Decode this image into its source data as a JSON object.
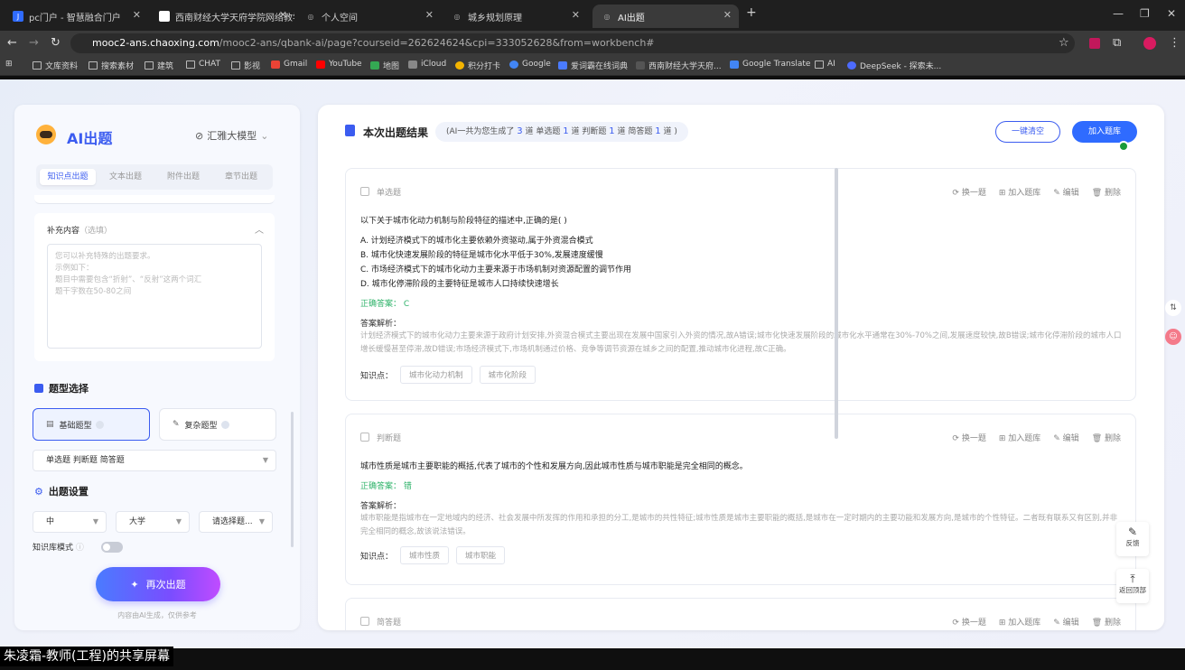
{
  "browser": {
    "tabs": [
      {
        "title": "pc门户 - 智慧融合门户",
        "favicon_color": "#2f6bff",
        "favicon_glyph": "J"
      },
      {
        "title": "西南财经大学天府学院网络教学",
        "favicon_color": "#ffffff",
        "favicon_glyph": ""
      },
      {
        "title": "个人空间",
        "favicon_color": "#666666",
        "favicon_glyph": "◎"
      },
      {
        "title": "城乡规划原理",
        "favicon_color": "#666666",
        "favicon_glyph": "◎"
      },
      {
        "title": "AI出题",
        "favicon_color": "#666666",
        "favicon_glyph": "◎"
      }
    ],
    "new_tab_icon": "plus-icon",
    "url_host": "mooc2-ans.chaoxing.com",
    "url_path": "/mooc2-ans/qbank-ai/page?courseid=262624624&cpi=333052628&from=workbench#",
    "bookmarks": [
      {
        "label": "文库资料",
        "color": ""
      },
      {
        "label": "搜索素材",
        "color": ""
      },
      {
        "label": "建筑",
        "color": ""
      },
      {
        "label": "CHAT",
        "color": ""
      },
      {
        "label": "影视",
        "color": ""
      },
      {
        "label": "Gmail",
        "color": "#ea4335"
      },
      {
        "label": "YouTube",
        "color": "#ff0000"
      },
      {
        "label": "地图",
        "color": "#34a853"
      },
      {
        "label": "iCloud",
        "color": "#888888"
      },
      {
        "label": "积分打卡",
        "color": "#f4b400"
      },
      {
        "label": "Google",
        "color": "#4285f4"
      },
      {
        "label": "爱词霸在线词典",
        "color": "#4a7bff"
      },
      {
        "label": "西南财经大学天府...",
        "color": "#3a3a3a"
      },
      {
        "label": "Google Translate",
        "color": "#4285f4"
      },
      {
        "label": "AI",
        "color": ""
      },
      {
        "label": "DeepSeek - 探索未...",
        "color": "#4d6bfe"
      }
    ]
  },
  "left_panel": {
    "title": "AI出题",
    "model_label": "汇雅大模型",
    "tabs": [
      {
        "label": "知识点出题",
        "active": true
      },
      {
        "label": "文本出题",
        "active": false
      },
      {
        "label": "附件出题",
        "active": false
      },
      {
        "label": "章节出题",
        "active": false
      }
    ],
    "supplement_title": "补充内容",
    "supplement_optional": "（选填）",
    "supplement_placeholder": [
      "您可以补充特殊的出题要求。",
      "示例如下：",
      "题目中需要包含“折射”、“反射”这两个词汇",
      "题干字数在50-80之间"
    ],
    "type_section_title": "题型选择",
    "basic_type_label": "基础题型",
    "complex_type_label": "复杂题型",
    "selected_types": "单选题 判断题 简答题",
    "settings_title": "出题设置",
    "difficulty": "中",
    "level": "大学",
    "extra_select": "请选择题...",
    "kb_mode_label": "知识库模式",
    "regen_label": "再次出题",
    "disclaimer": "内容由AI生成，仅供参考"
  },
  "results": {
    "title": "本次出题结果",
    "summary_prefix": "(AI一共为您生成了",
    "total": "3",
    "summary_mid1": "道 单选题",
    "single": "1",
    "summary_mid2": "道 判断题",
    "judge": "1",
    "summary_mid3": "道 简答题",
    "short": "1",
    "summary_suffix": "道 )",
    "clear_label": "一键清空",
    "add_bank_label": "加入题库",
    "actions": [
      "换一题",
      "加入题库",
      "编辑",
      "删除"
    ],
    "q1": {
      "type": "单选题",
      "stem": "以下关于城市化动力机制与阶段特征的描述中,正确的是( )",
      "options": [
        "A. 计划经济模式下的城市化主要依赖外资驱动,属于外资混合模式",
        "B. 城市化快速发展阶段的特征是城市化水平低于30%,发展速度缓慢",
        "C. 市场经济模式下的城市化动力主要来源于市场机制对资源配置的调节作用",
        "D. 城市化停滞阶段的主要特征是城市人口持续快速增长"
      ],
      "answer_label": "正确答案：",
      "answer": "C",
      "analysis_label": "答案解析：",
      "analysis": "计划经济模式下的城市化动力主要来源于政府计划安排,外资混合模式主要出现在发展中国家引入外资的情况,故A错误;城市化快速发展阶段的城市化水平通常在30%-70%之间,发展速度较快,故B错误;城市化停滞阶段的城市人口增长缓慢甚至停滞,故D错误;市场经济模式下,市场机制通过价格、竞争等调节资源在城乡之间的配置,推动城市化进程,故C正确。",
      "kp_label": "知识点：",
      "kps": [
        "城市化动力机制",
        "城市化阶段"
      ]
    },
    "q2": {
      "type": "判断题",
      "stem": "城市性质是城市主要职能的概括,代表了城市的个性和发展方向,因此城市性质与城市职能是完全相同的概念。",
      "answer_label": "正确答案：",
      "answer": "错",
      "analysis_label": "答案解析：",
      "analysis": "城市职能是指城市在一定地域内的经济、社会发展中所发挥的作用和承担的分工,是城市的共性特征;城市性质是城市主要职能的概括,是城市在一定时期内的主要功能和发展方向,是城市的个性特征。二者既有联系又有区别,并非完全相同的概念,故该说法错误。",
      "kp_label": "知识点：",
      "kps": [
        "城市性质",
        "城市职能"
      ]
    },
    "q3": {
      "type": "简答题"
    }
  },
  "side_buttons": {
    "feedback": "反馈",
    "top": "返回顶部"
  },
  "share_caption": "朱凌霜-教师(工程)的共享屏幕"
}
